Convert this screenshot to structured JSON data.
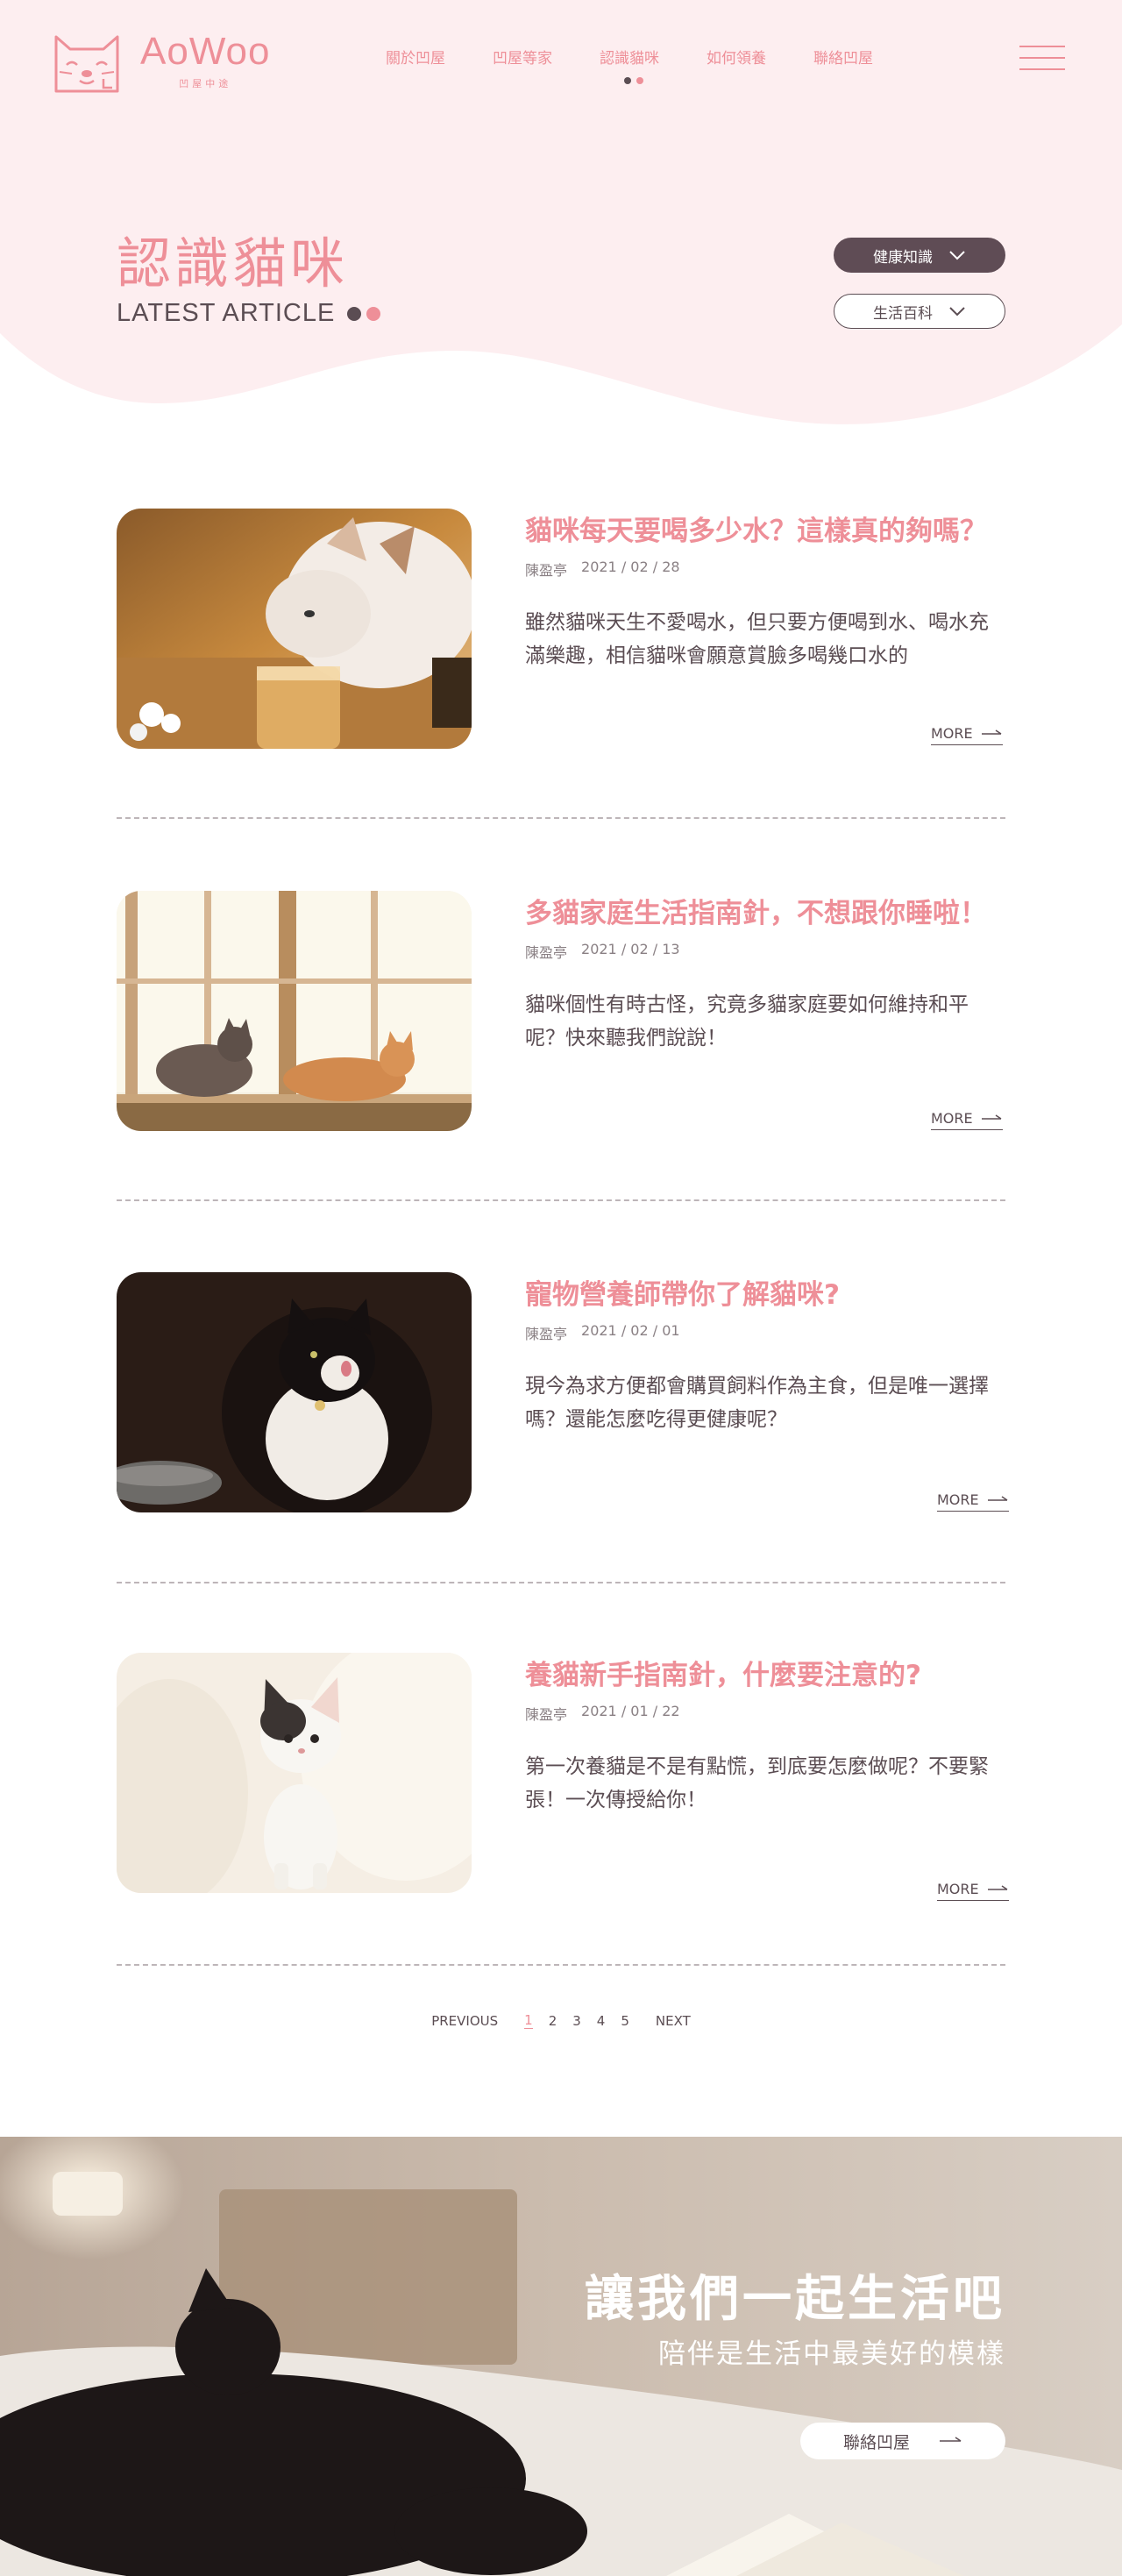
{
  "brand": {
    "name": "AoWoo",
    "tagline": "凹屋中途",
    "accent": "#ee8f98",
    "dark": "#5b4d53"
  },
  "nav": {
    "items": [
      {
        "label": "關於凹屋"
      },
      {
        "label": "凹屋等家"
      },
      {
        "label": "認識貓咪"
      },
      {
        "label": "如何領養"
      },
      {
        "label": "聯絡凹屋"
      }
    ],
    "active_index": 2
  },
  "hero": {
    "title": "認識貓咪",
    "subtitle": "LATEST ARTICLE",
    "filters": [
      {
        "label": "健康知識"
      },
      {
        "label": "生活百科"
      }
    ]
  },
  "articles": [
    {
      "title": "貓咪每天要喝多少水？這樣真的夠嗎？",
      "author": "陳盈亭",
      "date": "2021 / 02 / 28",
      "excerpt": "雖然貓咪天生不愛喝水，但只要方便喝到水、喝水充滿樂趣，相信貓咪會願意賞臉多喝幾口水的",
      "more": "MORE",
      "image": "cat-drinking-water-photo"
    },
    {
      "title": "多貓家庭生活指南針，不想跟你睡啦！",
      "author": "陳盈亭",
      "date": "2021 / 02 / 13",
      "excerpt": "貓咪個性有時古怪，究竟多貓家庭要如何維持和平呢？快來聽我們說說！",
      "more": "MORE",
      "image": "two-cats-by-window-photo"
    },
    {
      "title": "寵物營養師帶你了解貓咪?",
      "author": "陳盈亭",
      "date": "2021 / 02 / 01",
      "excerpt": "現今為求方便都會購買飼料作為主食，但是唯一選擇嗎？還能怎麼吃得更健康呢？",
      "more": "MORE",
      "image": "black-white-cat-licking-photo"
    },
    {
      "title": "養貓新手指南針，什麼要注意的?",
      "author": "陳盈亭",
      "date": "2021 / 01 / 22",
      "excerpt": "第一次養貓是不是有點慌，到底要怎麼做呢？不要緊張！一次傳授給你！",
      "more": "MORE",
      "image": "kitten-sitting-photo"
    }
  ],
  "pagination": {
    "previous": "PREVIOUS",
    "pages": [
      "1",
      "2",
      "3",
      "4",
      "5"
    ],
    "current": "1",
    "next": "NEXT"
  },
  "banner": {
    "title": "讓我們一起生活吧",
    "subtitle": "陪伴是生活中最美好的模樣",
    "button": "聯絡凹屋",
    "image": "black-cat-sleeping-on-bed-photo"
  }
}
